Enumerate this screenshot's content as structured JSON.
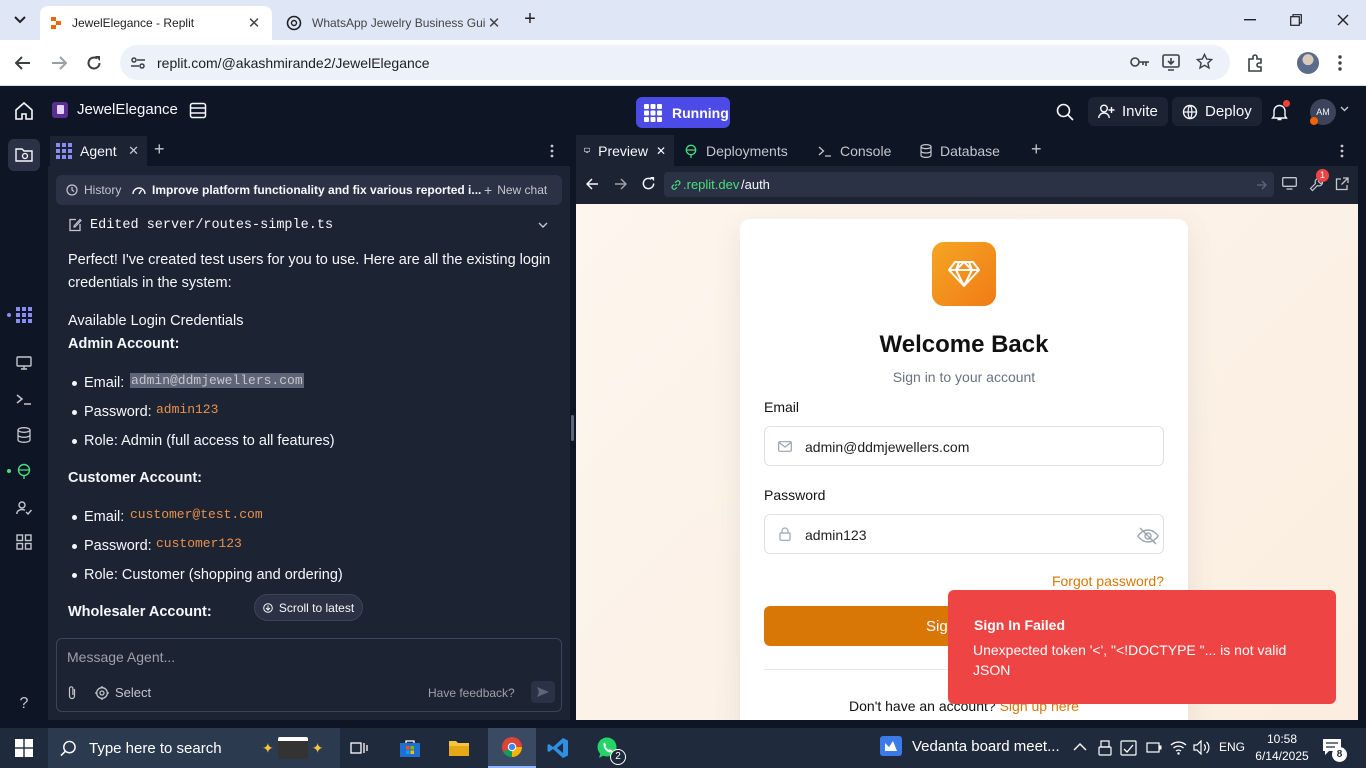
{
  "browser": {
    "tabs": [
      {
        "title": "JewelElegance - Replit",
        "active": true
      },
      {
        "title": "WhatsApp Jewelry Business Gui",
        "active": false
      }
    ],
    "url": "replit.com/@akashmirande2/JewelElegance"
  },
  "replit_header": {
    "project_name": "JewelElegance",
    "status": "Running",
    "invite_label": "Invite",
    "deploy_label": "Deploy",
    "avatar_initials": "AM"
  },
  "agent": {
    "tab_label": "Agent",
    "history_label": "History",
    "chat_title": "Improve platform functionality and fix various reported i...",
    "new_chat_label": "New chat",
    "edited_file": "Edited server/routes-simple.ts",
    "intro": "Perfect! I've created test users for you to use. Here are all the existing login credentials in the system:",
    "section_title": "Available Login Credentials",
    "admin": {
      "heading": "Admin Account:",
      "email_label": "Email:",
      "email": "admin@ddmjewellers.com",
      "password_label": "Password:",
      "password": "admin123",
      "role": "Role: Admin (full access to all features)"
    },
    "customer": {
      "heading": "Customer Account:",
      "email_label": "Email:",
      "email": "customer@test.com",
      "password_label": "Password:",
      "password": "customer123",
      "role": "Role: Customer (shopping and ordering)"
    },
    "wholesaler_heading": "Wholesaler Account:",
    "scroll_latest": "Scroll to latest",
    "input_placeholder": "Message Agent...",
    "select_label": "Select",
    "feedback_label": "Have feedback?"
  },
  "preview": {
    "tabs": [
      "Preview",
      "Deployments",
      "Console",
      "Database"
    ],
    "url_domain": ".replit.dev",
    "url_path": "/auth",
    "notification_count": "1",
    "login": {
      "title": "Welcome Back",
      "subtitle": "Sign in to your account",
      "email_label": "Email",
      "email_value": "admin@ddmjewellers.com",
      "password_label": "Password",
      "password_value": "admin123",
      "forgot": "Forgot password?",
      "signin_label": "Sign In",
      "no_account": "Don't have an account?",
      "signup": "Sign up here"
    }
  },
  "toast": {
    "title": "Sign In Failed",
    "message": "Unexpected token '<', \"<!DOCTYPE \"... is not valid JSON"
  },
  "taskbar": {
    "search_placeholder": "Type here to search",
    "whatsapp_badge": "2",
    "meeting": "Vedanta board meet...",
    "language": "ENG",
    "time": "10:58",
    "date": "6/14/2025",
    "notification_count": "8"
  },
  "colors": {
    "replit_bg": "#0e1525",
    "panel_bg": "#1c2333",
    "running_purple": "#4d4be7",
    "code_orange": "#e8914b",
    "signin_orange": "#d97706",
    "toast_red": "#ef4444"
  }
}
